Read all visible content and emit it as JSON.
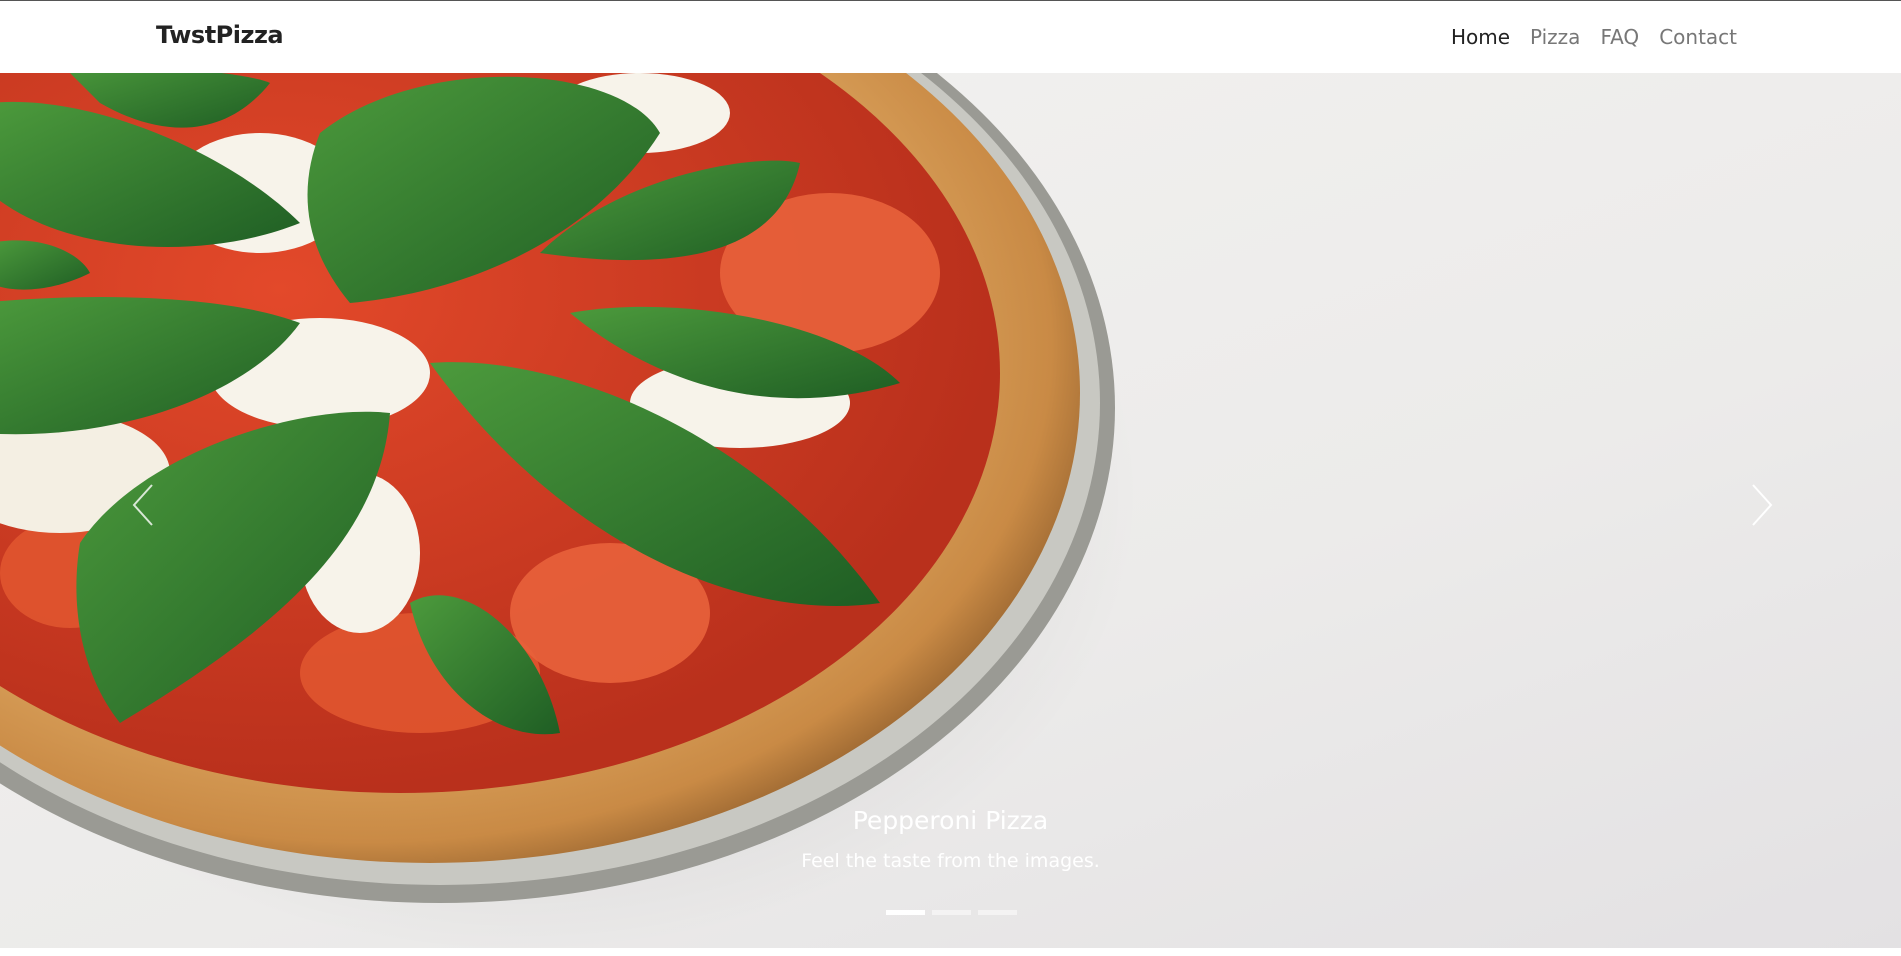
{
  "brand": {
    "name": "TwstPizza"
  },
  "nav": {
    "items": [
      {
        "label": "Home",
        "active": true
      },
      {
        "label": "Pizza",
        "active": false
      },
      {
        "label": "FAQ",
        "active": false
      },
      {
        "label": "Contact",
        "active": false
      }
    ]
  },
  "hero": {
    "caption_title": "Pepperoni Pizza",
    "caption_text": "Feel the taste from the images.",
    "slide_count": 3,
    "active_slide": 1,
    "image_description": "margherita pizza with basil leaves and mozzarella on a metal tray"
  },
  "colors": {
    "brand_text": "#222222",
    "nav_inactive": "#777777",
    "caption_text": "#ffffff"
  },
  "icons": {
    "prev": "chevron-left-icon",
    "next": "chevron-right-icon"
  }
}
